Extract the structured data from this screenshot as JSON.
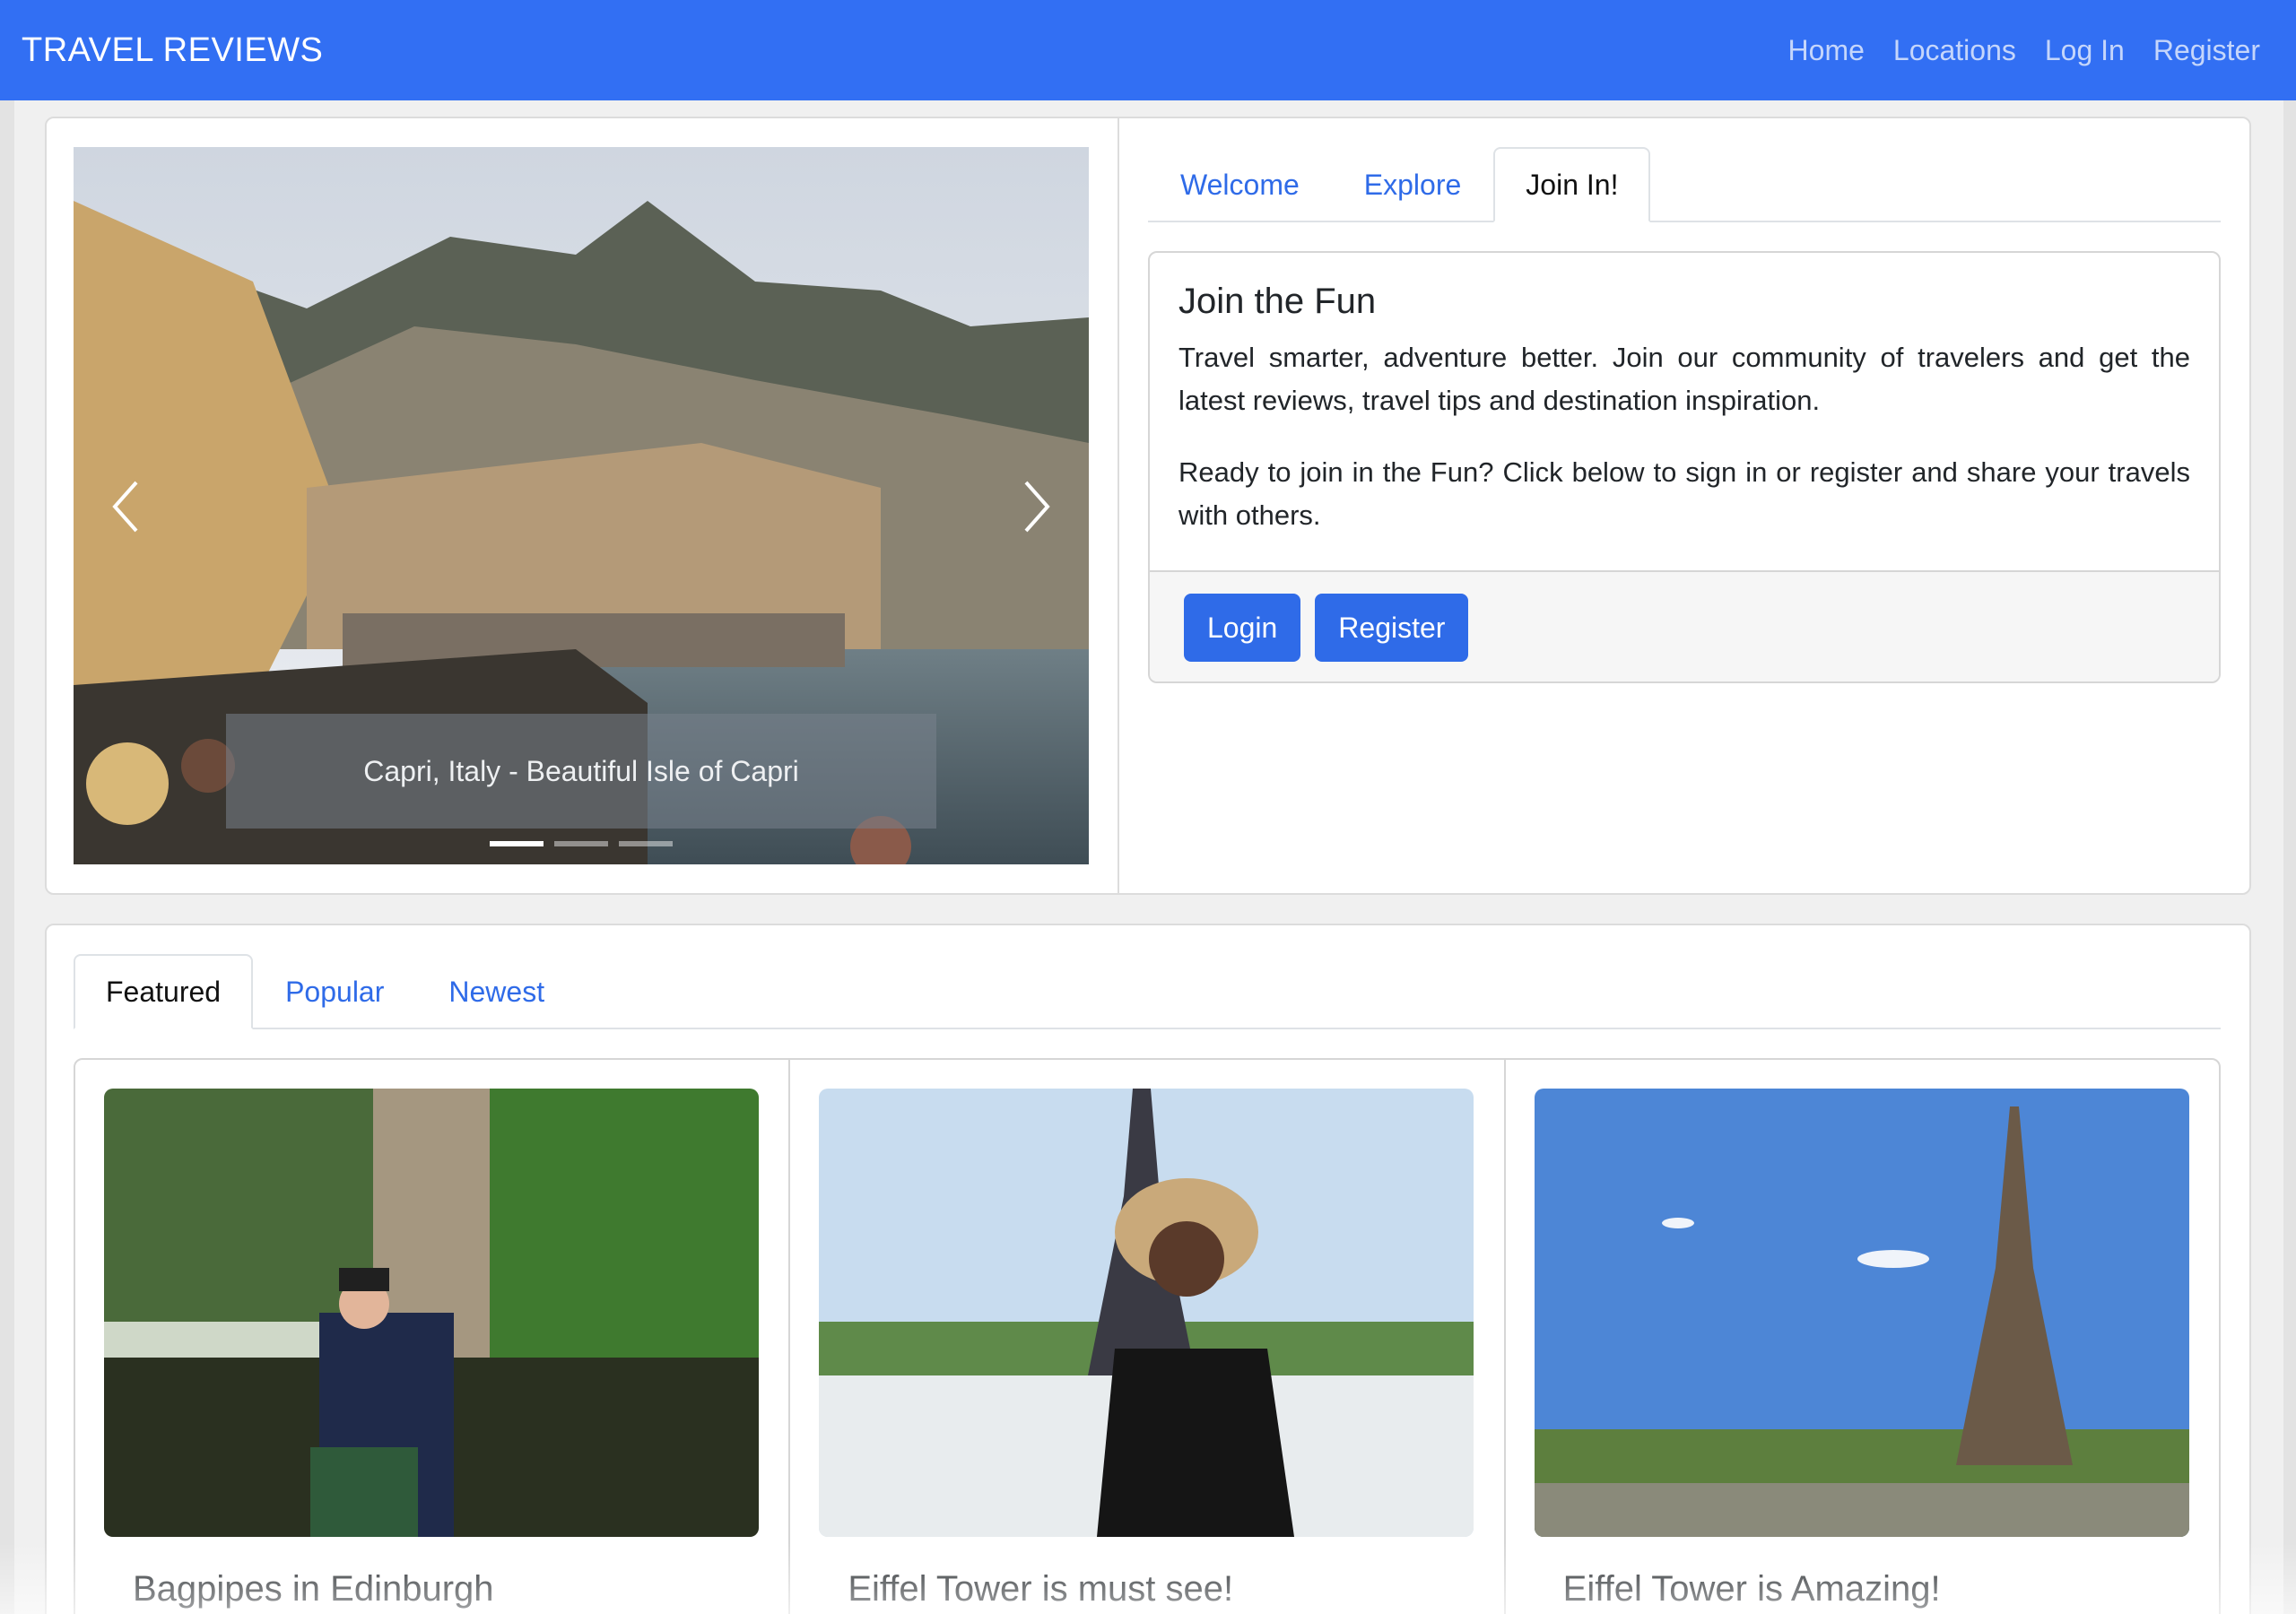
{
  "navbar": {
    "brand": "TRAVEL REVIEWS",
    "links": [
      "Home",
      "Locations",
      "Log In",
      "Register"
    ]
  },
  "carousel": {
    "caption": "Capri, Italy - Beautiful Isle of Capri",
    "active_index": 0,
    "slide_count": 3
  },
  "info_tabs": {
    "tabs": [
      "Welcome",
      "Explore",
      "Join In!"
    ],
    "active": "Join In!"
  },
  "join": {
    "title": "Join the Fun",
    "paragraph1": "Travel smarter, adventure better. Join our community of travelers and get the latest reviews, travel tips and destination inspiration.",
    "paragraph2": "Ready to join in the Fun? Click below to sign in or register and share your travels with others.",
    "login_label": "Login",
    "register_label": "Register"
  },
  "listing_tabs": {
    "tabs": [
      "Featured",
      "Popular",
      "Newest"
    ],
    "active": "Featured"
  },
  "features": [
    {
      "title": "Bagpipes in Edinburgh"
    },
    {
      "title": "Eiffel Tower is must see!"
    },
    {
      "title": "Eiffel Tower is Amazing!"
    }
  ],
  "colors": {
    "navbar": "#326ff3",
    "primary": "#2f6be8"
  }
}
